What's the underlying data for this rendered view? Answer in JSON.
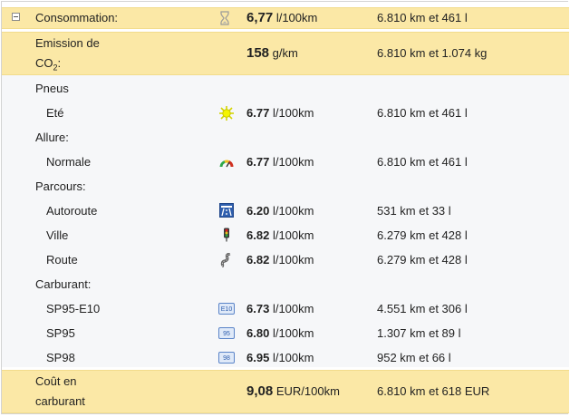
{
  "consommation": {
    "label": "Consommation:",
    "value": "6,77",
    "unit": "l/100km",
    "distance": "6.810 km et 461 l"
  },
  "emission": {
    "label_line1": "Emission de",
    "label_co": "CO",
    "label_sub": "2",
    "label_colon": ":",
    "value": "158",
    "unit": "g/km",
    "distance": "6.810 km et 1.074 kg"
  },
  "sections": {
    "pneus": {
      "title": "Pneus",
      "items": [
        {
          "label": "Eté",
          "icon": "sun-icon",
          "value": "6.77",
          "unit": "l/100km",
          "distance": "6.810 km et 461 l"
        }
      ]
    },
    "allure": {
      "title": "Allure:",
      "items": [
        {
          "label": "Normale",
          "icon": "gauge-icon",
          "value": "6.77",
          "unit": "l/100km",
          "distance": "6.810 km et 461 l"
        }
      ]
    },
    "parcours": {
      "title": "Parcours:",
      "items": [
        {
          "label": "Autoroute",
          "icon": "highway-icon",
          "value": "6.20",
          "unit": "l/100km",
          "distance": "531 km et 33 l"
        },
        {
          "label": "Ville",
          "icon": "traffic-light-icon",
          "value": "6.82",
          "unit": "l/100km",
          "distance": "6.279 km et 428 l"
        },
        {
          "label": "Route",
          "icon": "winding-road-icon",
          "value": "6.82",
          "unit": "l/100km",
          "distance": "6.279 km et 428 l"
        }
      ]
    },
    "carburant": {
      "title": "Carburant:",
      "items": [
        {
          "label": "SP95-E10",
          "icon": "fuel-e10-icon",
          "tag": "E10",
          "value": "6.73",
          "unit": "l/100km",
          "distance": "4.551 km et 306 l"
        },
        {
          "label": "SP95",
          "icon": "fuel-95-icon",
          "tag": "95",
          "value": "6.80",
          "unit": "l/100km",
          "distance": "1.307 km et 89 l"
        },
        {
          "label": "SP98",
          "icon": "fuel-98-icon",
          "tag": "98",
          "value": "6.95",
          "unit": "l/100km",
          "distance": "952 km et 66 l"
        }
      ]
    }
  },
  "cout": {
    "label_line1": "Coût en",
    "label_line2": "carburant",
    "value": "9,08",
    "unit": "EUR/100km",
    "distance": "6.810 km et 618 EUR"
  },
  "colors": {
    "highlight": "#fbe8a6",
    "subsection": "#f6f7f9",
    "fuel_tag": "#5a84c8"
  }
}
